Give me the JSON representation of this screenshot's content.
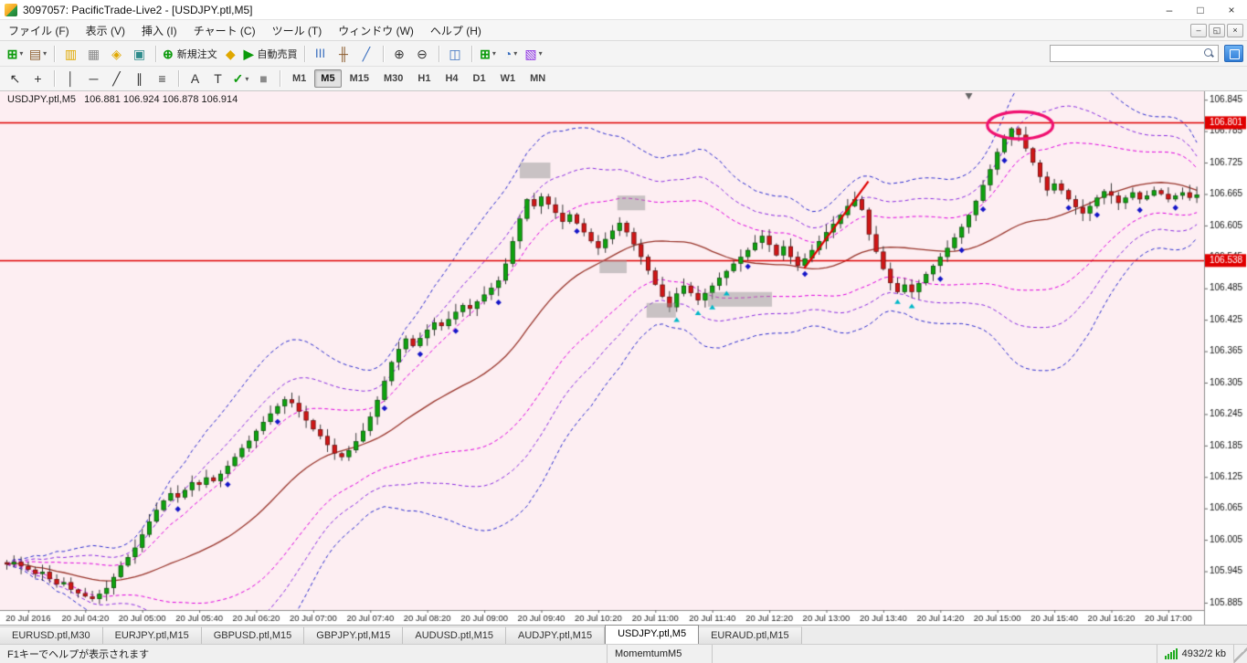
{
  "window": {
    "title": "3097057: PacificTrade-Live2 - [USDJPY.ptl,M5]"
  },
  "menu": {
    "items": [
      "ファイル (F)",
      "表示 (V)",
      "挿入 (I)",
      "チャート (C)",
      "ツール (T)",
      "ウィンドウ (W)",
      "ヘルプ (H)"
    ]
  },
  "toolbar": {
    "new_order_label": "新規注文",
    "auto_trading_label": "自動売買",
    "search_placeholder": ""
  },
  "icons": {
    "caret": "▾",
    "new_chart": "⊞",
    "profiles": "▤",
    "market_watch": "▥",
    "data_window": "▦",
    "navigator": "◈",
    "terminal": "▣",
    "new_order": "⊕",
    "metaeditor": "◆",
    "auto_trading": "▶",
    "chart_bars": "|||",
    "chart_candles": "╫",
    "chart_line": "╱",
    "zoom_in": "⊕",
    "zoom_out": "⊖",
    "tile_windows": "◫",
    "indicators": "⊞",
    "periods": "◔",
    "templates": "▧",
    "cursor": "↖",
    "crosshair": "+",
    "vline": "│",
    "hline": "─",
    "trendline": "╱",
    "channel": "∥",
    "fibonacci": "≡",
    "text": "A",
    "label": "T",
    "arrows": "✓",
    "shapes": "■",
    "win_min": "–",
    "win_max": "□",
    "win_close": "×",
    "mdi_min": "–",
    "mdi_restore": "◱",
    "mdi_close": "×"
  },
  "timeframes": {
    "items": [
      "M1",
      "M5",
      "M15",
      "M30",
      "H1",
      "H4",
      "D1",
      "W1",
      "MN"
    ],
    "active": "M5"
  },
  "chart": {
    "symbol": "USDJPY.ptl,M5",
    "ohlc": "106.881 106.924 106.878 106.914"
  },
  "chart_data": {
    "type": "candlestick",
    "symbol": "USDJPY.ptl,M5",
    "timeframe": "M5",
    "title": "USDJPY 5-minute chart with Bollinger bands, two red horizontal lines, red trendline and pink ellipse annotation",
    "ylim": [
      105.871,
      106.861
    ],
    "price_ticks": [
      106.845,
      106.785,
      106.725,
      106.665,
      106.605,
      106.545,
      106.485,
      106.425,
      106.365,
      106.305,
      106.245,
      106.185,
      106.125,
      106.065,
      106.005,
      105.945,
      105.885
    ],
    "time_labels": [
      "20 Jul 2016",
      "20 Jul 04:20",
      "20 Jul 05:00",
      "20 Jul 05:40",
      "20 Jul 06:20",
      "20 Jul 07:00",
      "20 Jul 07:40",
      "20 Jul 08:20",
      "20 Jul 09:00",
      "20 Jul 09:40",
      "20 Jul 10:20",
      "20 Jul 11:00",
      "20 Jul 11:40",
      "20 Jul 12:20",
      "20 Jul 13:00",
      "20 Jul 13:40",
      "20 Jul 14:20",
      "20 Jul 15:00",
      "20 Jul 15:40",
      "20 Jul 16:20",
      "20 Jul 17:00"
    ],
    "first_label_index": 3,
    "label_step": 8,
    "open_offset_first": 0.004,
    "closes": [
      105.958,
      105.963,
      105.955,
      105.948,
      105.94,
      105.944,
      105.93,
      105.92,
      105.924,
      105.91,
      105.903,
      105.897,
      105.892,
      105.902,
      105.913,
      105.934,
      105.956,
      105.972,
      105.99,
      106.015,
      106.04,
      106.062,
      106.08,
      106.094,
      106.086,
      106.1,
      106.115,
      106.11,
      106.124,
      106.117,
      106.131,
      106.146,
      106.163,
      106.18,
      106.194,
      106.213,
      106.23,
      106.246,
      106.26,
      106.273,
      106.266,
      106.25,
      106.233,
      106.216,
      106.203,
      106.186,
      106.17,
      106.163,
      106.176,
      106.193,
      106.213,
      106.24,
      106.272,
      106.308,
      106.344,
      106.369,
      106.389,
      106.375,
      106.39,
      106.406,
      106.42,
      106.413,
      106.426,
      106.44,
      106.453,
      106.446,
      106.46,
      106.473,
      106.486,
      106.5,
      106.532,
      106.575,
      106.618,
      106.655,
      106.642,
      106.66,
      106.645,
      106.629,
      106.612,
      106.626,
      106.609,
      106.592,
      106.575,
      106.562,
      106.579,
      106.595,
      106.61,
      106.592,
      106.569,
      106.545,
      106.519,
      106.492,
      106.469,
      106.449,
      106.475,
      106.49,
      106.476,
      106.462,
      106.476,
      106.49,
      106.505,
      106.518,
      106.532,
      106.545,
      106.558,
      106.572,
      106.585,
      106.568,
      106.548,
      106.565,
      106.545,
      106.528,
      106.542,
      106.558,
      106.575,
      106.592,
      106.608,
      106.625,
      106.642,
      106.655,
      106.635,
      106.588,
      106.555,
      106.522,
      106.495,
      106.478,
      106.492,
      106.478,
      106.495,
      106.512,
      106.528,
      106.545,
      106.562,
      106.582,
      106.602,
      106.625,
      106.652,
      106.682,
      106.712,
      106.745,
      106.772,
      106.79,
      106.778,
      106.752,
      106.725,
      106.698,
      106.672,
      106.685,
      106.672,
      106.655,
      106.64,
      106.628,
      106.642,
      106.658,
      106.67,
      106.662,
      106.648,
      106.658,
      106.668,
      106.655,
      106.662,
      106.672,
      106.665,
      106.655,
      106.662,
      106.668,
      106.658,
      106.664
    ],
    "bollinger": {
      "period": 26,
      "deviations": [
        2.8,
        2.0,
        1.3
      ],
      "band_colors": [
        "#2b2bd0",
        "#8a2be2",
        "#e000e0"
      ],
      "mid_color": "#99352b"
    },
    "hlines": [
      {
        "price": 106.801,
        "label": "106.801",
        "color": "#e00000"
      },
      {
        "price": 106.538,
        "label": "106.538",
        "color": "#e00000"
      }
    ],
    "trendline": {
      "i1": 111.9,
      "p1": 106.523,
      "i2": 120.9,
      "p2": 106.689,
      "color": "#e00000"
    },
    "ellipse": {
      "i": 142.2,
      "p": 106.796,
      "rx": 4.6,
      "ry": 0.026,
      "color": "#f01070"
    },
    "shift_marker_i": 135,
    "boxes": [
      {
        "i1": 72.3,
        "i2": 76.6,
        "p1": 106.695,
        "p2": 106.725
      },
      {
        "i1": 86.0,
        "i2": 89.9,
        "p1": 106.634,
        "p2": 106.662
      },
      {
        "i1": 83.5,
        "i2": 87.3,
        "p1": 106.514,
        "p2": 106.539
      },
      {
        "i1": 90.1,
        "i2": 94.2,
        "p1": 106.429,
        "p2": 106.457
      },
      {
        "i1": 98.7,
        "i2": 107.7,
        "p1": 106.45,
        "p2": 106.478
      }
    ],
    "markers": {
      "diamond_color": "#1515c8",
      "arrow_color": "#00b8c8",
      "diamonds": [
        24,
        31,
        38,
        53,
        58,
        63,
        69,
        80,
        104,
        112,
        131,
        134,
        137,
        140,
        149,
        153,
        159,
        164
      ],
      "arrows": [
        94,
        97,
        99,
        101,
        125,
        127
      ]
    },
    "colors": {
      "bg": "#fdeef2",
      "up": "#0ea30e",
      "down": "#d01616",
      "wick": "#3a3a3a"
    }
  },
  "tabs": {
    "items": [
      "EURUSD.ptl,M30",
      "EURJPY.ptl,M15",
      "GBPUSD.ptl,M15",
      "GBPJPY.ptl,M15",
      "AUDUSD.ptl,M15",
      "AUDJPY.ptl,M15",
      "USDJPY.ptl,M5",
      "EURAUD.ptl,M15"
    ],
    "active": "USDJPY.ptl,M5"
  },
  "statusbar": {
    "help": "F1キーでヘルプが表示されます",
    "indicator": "MomemtumM5",
    "traffic": "4932/2 kb"
  }
}
